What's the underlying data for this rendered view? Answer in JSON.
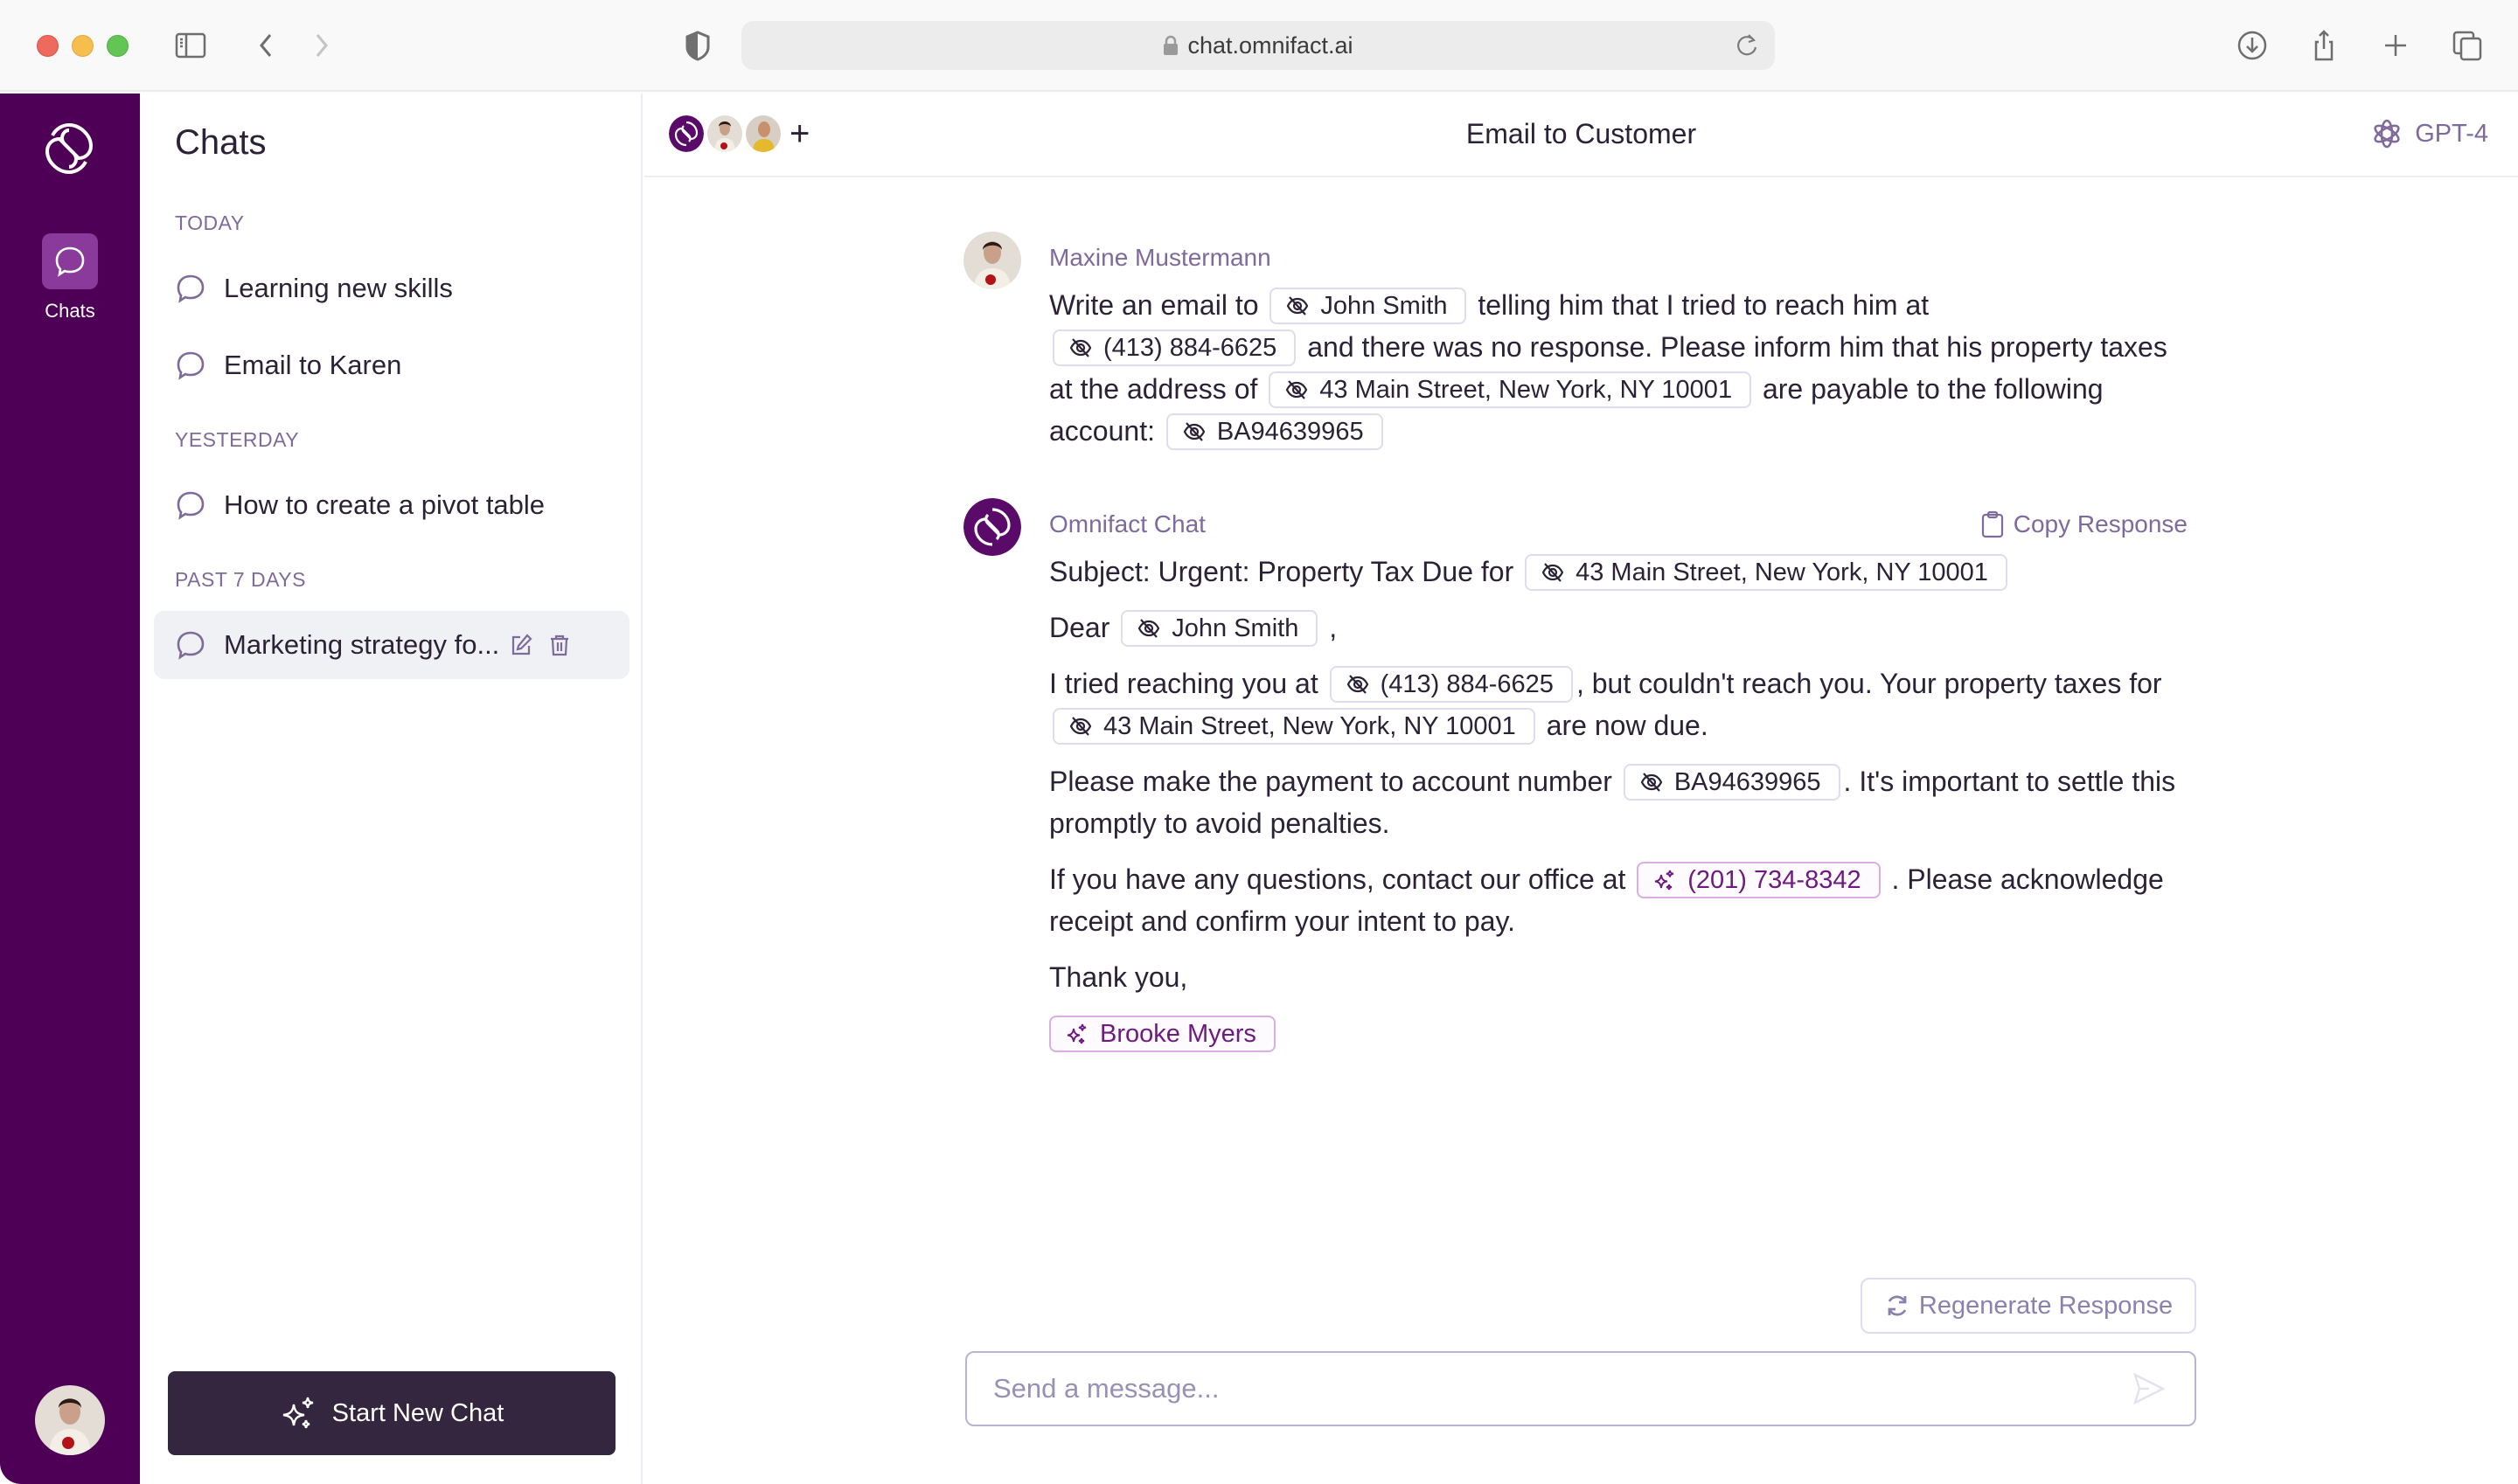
{
  "browser": {
    "url": "chat.omnifact.ai"
  },
  "rail": {
    "items": [
      {
        "label": "Chats",
        "icon": "chat-bubble-icon",
        "active": true
      }
    ]
  },
  "chats_panel": {
    "title": "Chats",
    "sections": [
      {
        "label": "TODAY",
        "items": [
          {
            "title": "Learning new skills"
          },
          {
            "title": "Email to Karen"
          }
        ]
      },
      {
        "label": "YESTERDAY",
        "items": [
          {
            "title": "How to create a pivot table"
          }
        ]
      },
      {
        "label": "PAST 7 DAYS",
        "items": [
          {
            "title": "Marketing strategy fo...",
            "active": true
          }
        ]
      }
    ],
    "new_chat_label": "Start New Chat"
  },
  "chat": {
    "title": "Email to Customer",
    "model": "GPT-4",
    "copy_label": "Copy Response",
    "regenerate_label": "Regenerate Response",
    "input_placeholder": "Send a message...",
    "input_value": "",
    "user_message": {
      "author": "Maxine Mustermann",
      "t1": "Write an email to",
      "chip_name": "John Smith",
      "t2": "telling him that I tried to reach him at",
      "chip_phone": "(413) 884-6625",
      "t3": "and there was no response. Please inform him that his property taxes at the address of",
      "chip_address": "43 Main Street, New York, NY 10001",
      "t4": "are payable to the following account:",
      "chip_account": "BA94639965"
    },
    "assistant_message": {
      "author": "Omnifact Chat",
      "subject_prefix": "Subject: Urgent: Property Tax Due for",
      "chip_address": "43 Main Street, New York, NY 10001",
      "dear": "Dear",
      "chip_name": "John Smith",
      "comma": ",",
      "p2_a": "I tried reaching you at",
      "chip_phone": "(413) 884-6625",
      "p2_b": ", but couldn't reach you. Your property taxes for",
      "chip_address2": "43 Main Street, New York, NY 10001",
      "p2_c": "are now due.",
      "p3_a": "Please make the payment to account number",
      "chip_account": "BA94639965",
      "p3_b": ". It's important to settle this promptly to avoid penalties.",
      "p4_a": "If you have any questions, contact our office at",
      "chip_office_phone": "(201) 734-8342",
      "p4_b": ". Please acknowledge receipt and confirm your intent to pay.",
      "closing": "Thank you,",
      "chip_signature": "Brooke Myers"
    }
  },
  "colors": {
    "brand_purple": "#4e0057",
    "accent_muted": "#7f6a9c",
    "ai_chip_text": "#6e1a80",
    "button_dark": "#33263e"
  }
}
